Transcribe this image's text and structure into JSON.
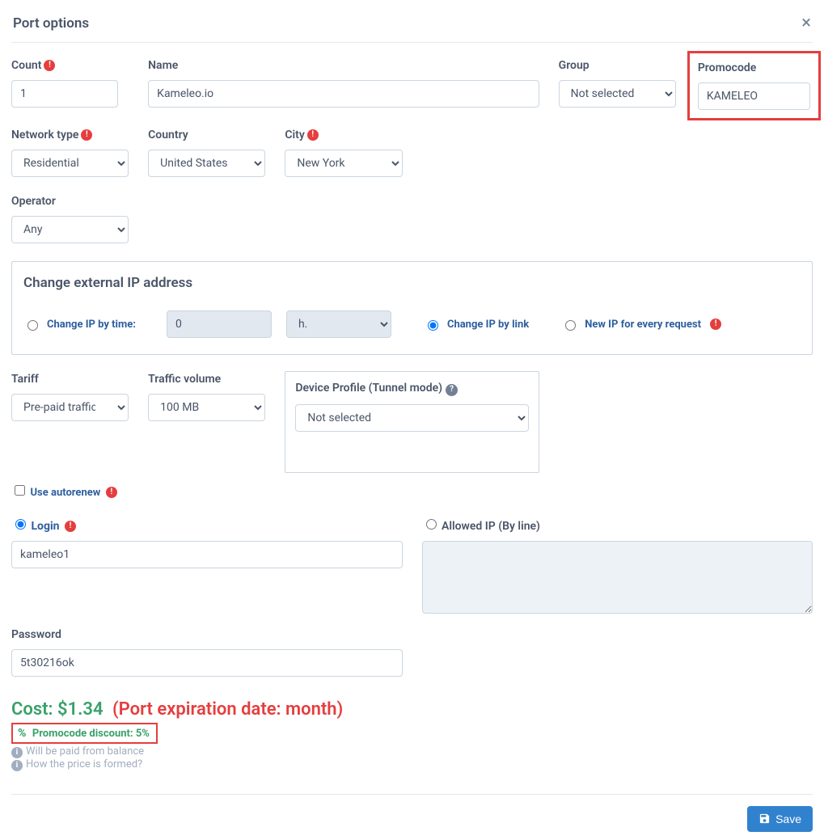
{
  "header": {
    "title": "Port options"
  },
  "fields": {
    "count": {
      "label": "Count",
      "value": "1"
    },
    "name": {
      "label": "Name",
      "value": "Kameleo.io"
    },
    "group": {
      "label": "Group",
      "selected": "Not selected"
    },
    "promocode": {
      "label": "Promocode",
      "value": "KAMELEO"
    },
    "network_type": {
      "label": "Network type",
      "selected": "Residential"
    },
    "country": {
      "label": "Country",
      "selected": "United States"
    },
    "city": {
      "label": "City",
      "selected": "New York"
    },
    "operator": {
      "label": "Operator",
      "selected": "Any"
    },
    "tariff": {
      "label": "Tariff",
      "selected": "Pre-paid traffic"
    },
    "traffic_volume": {
      "label": "Traffic volume",
      "selected": "100 MB"
    },
    "device_profile": {
      "label": "Device Profile (Tunnel mode)",
      "selected": "Not selected"
    },
    "autorenew": {
      "label": "Use autorenew",
      "checked": false
    },
    "login": {
      "label": "Login",
      "value": "kameleo1"
    },
    "password": {
      "label": "Password",
      "value": "5t30216ok"
    },
    "allowed_ip": {
      "label": "Allowed IP (By line)"
    }
  },
  "change_ip": {
    "title": "Change external IP address",
    "by_time_label": "Change IP by time:",
    "by_time_value": "0",
    "unit_selected": "h.",
    "by_link_label": "Change IP by link",
    "every_request_label": "New IP for every request"
  },
  "cost": {
    "prefix": "Cost: ",
    "amount": "$1.34",
    "expiration": "(Port expiration date: month)",
    "discount_label": "Promocode discount: 5%",
    "note_balance": "Will be paid from balance",
    "note_price_link": "How the price is formed?"
  },
  "footer": {
    "save_label": "Save"
  }
}
